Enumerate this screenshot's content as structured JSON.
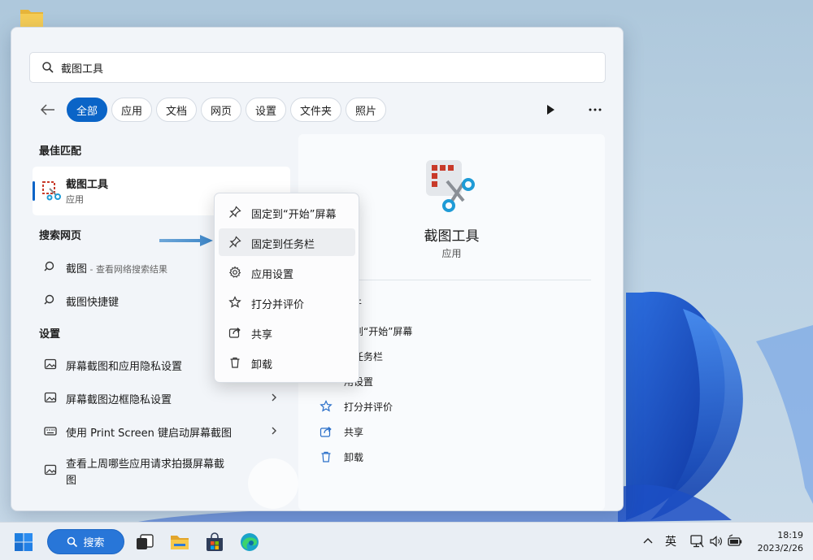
{
  "search": {
    "query": "截图工具"
  },
  "filters": {
    "tabs": [
      "全部",
      "应用",
      "文档",
      "网页",
      "设置",
      "文件夹",
      "照片"
    ],
    "active_index": 0
  },
  "sections": {
    "best_match": "最佳匹配",
    "web_search": "搜索网页",
    "settings": "设置"
  },
  "best_match": {
    "title": "截图工具",
    "subtitle": "应用"
  },
  "web_results": [
    {
      "label": "截图",
      "suffix": " - 查看网络搜索结果"
    },
    {
      "label": "截图快捷键",
      "suffix": ""
    }
  ],
  "settings_results": [
    {
      "label": "屏幕截图和应用隐私设置",
      "icon": "image-icon",
      "has_chevron": false
    },
    {
      "label": "屏幕截图边框隐私设置",
      "icon": "image-icon",
      "has_chevron": true
    },
    {
      "label": "使用 Print Screen 键启动屏幕截图",
      "icon": "keyboard-icon",
      "has_chevron": true
    },
    {
      "label": "查看上周哪些应用请求拍摄屏幕截",
      "label2": "图",
      "icon": "image-icon",
      "has_chevron": false
    }
  ],
  "context_menu": {
    "items": [
      {
        "label": "固定到“开始”屏幕",
        "icon": "pin-icon"
      },
      {
        "label": "固定到任务栏",
        "icon": "pin-icon",
        "highlighted": true
      },
      {
        "label": "应用设置",
        "icon": "gear-icon"
      },
      {
        "label": "打分并评价",
        "icon": "star-rate-icon"
      },
      {
        "label": "共享",
        "icon": "share-icon"
      },
      {
        "label": "卸载",
        "icon": "trash-icon"
      }
    ]
  },
  "detail": {
    "title": "截图工具",
    "subtitle": "应用",
    "open_stub": "开",
    "actions": [
      {
        "label": "定到“开始”屏幕"
      },
      {
        "label": "到任务栏"
      },
      {
        "label": "用设置"
      },
      {
        "label": "打分并评价"
      },
      {
        "label": "共享"
      },
      {
        "label": "卸载"
      }
    ]
  },
  "taskbar": {
    "search_label": "搜索",
    "ime": "英",
    "time": "18:19",
    "date": "2023/2/26"
  },
  "colors": {
    "accent": "#0a64c7",
    "taskbar_search": "#2876d8",
    "snip_red": "#c83a2a",
    "snip_teal": "#1f9bd6"
  }
}
